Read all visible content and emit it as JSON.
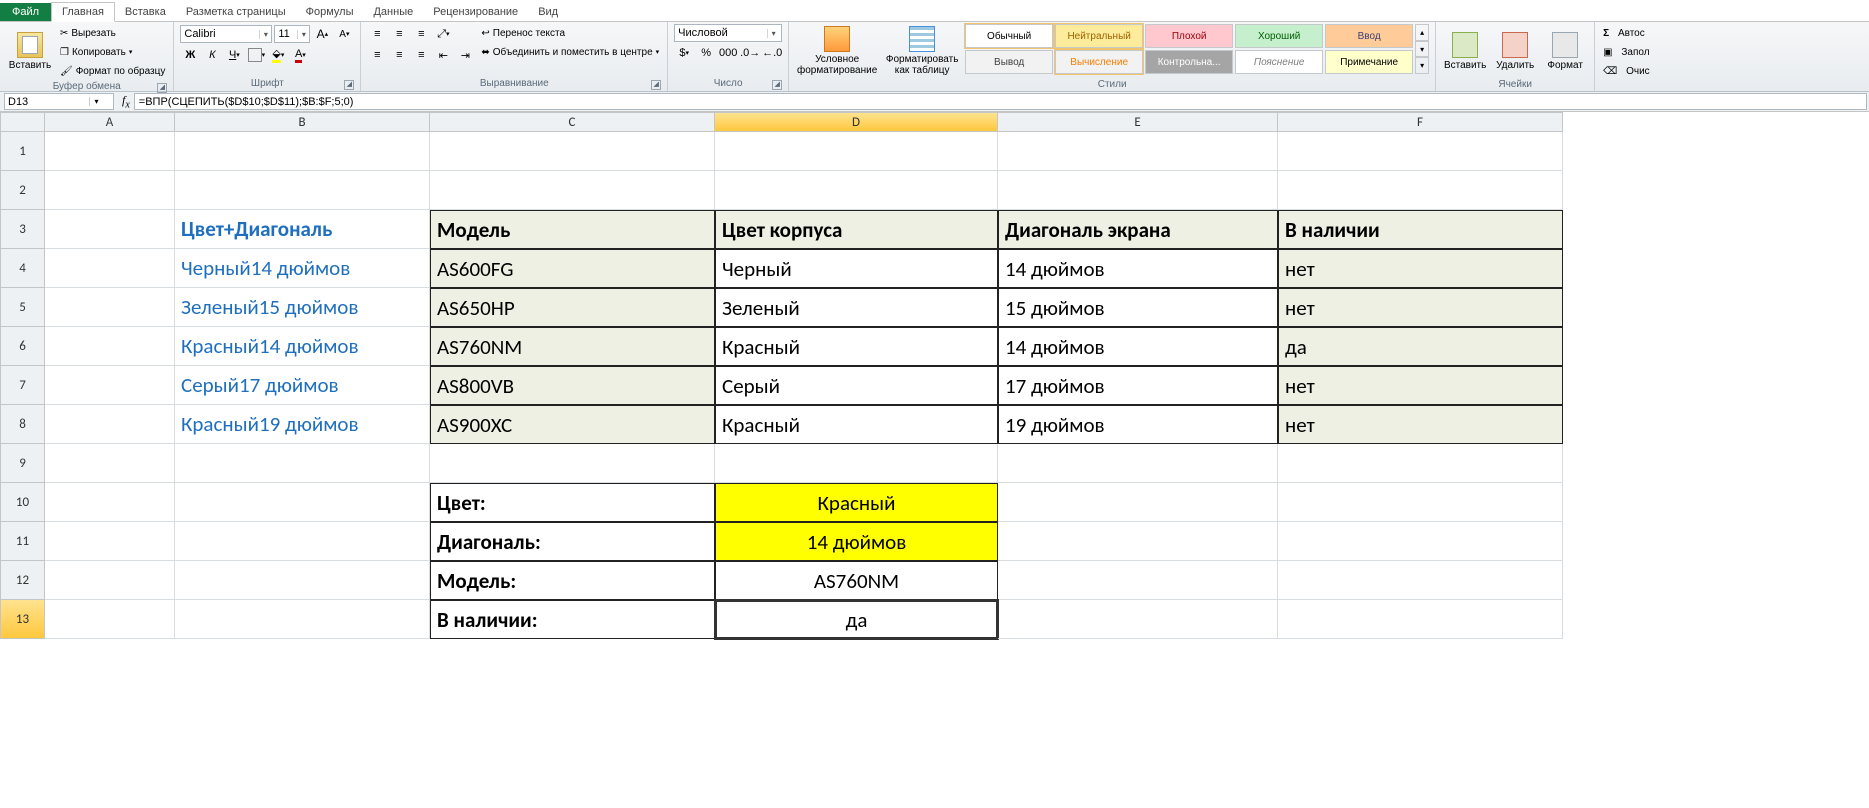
{
  "tabs": {
    "file": "Файл",
    "items": [
      "Главная",
      "Вставка",
      "Разметка страницы",
      "Формулы",
      "Данные",
      "Рецензирование",
      "Вид"
    ],
    "active": 0
  },
  "ribbon": {
    "clipboard": {
      "paste": "Вставить",
      "cut": "Вырезать",
      "copy": "Копировать",
      "format_painter": "Формат по образцу",
      "title": "Буфер обмена"
    },
    "font": {
      "name": "Calibri",
      "size": "11",
      "title": "Шрифт"
    },
    "alignment": {
      "wrap": "Перенос текста",
      "merge": "Объединить и поместить в центре",
      "title": "Выравнивание"
    },
    "number": {
      "format": "Числовой",
      "thousands_sep": "000",
      "title": "Число"
    },
    "styles": {
      "cond_fmt": "Условное форматирование",
      "as_table": "Форматировать как таблицу",
      "gallery": [
        {
          "label": "Обычный",
          "bg": "#ffffff",
          "color": "#000",
          "border": "#f0c36d"
        },
        {
          "label": "Нейтральный",
          "bg": "#ffeb9c",
          "color": "#9c6500",
          "border": "#f0c36d"
        },
        {
          "label": "Плохой",
          "bg": "#ffc7ce",
          "color": "#9c0006"
        },
        {
          "label": "Хороший",
          "bg": "#c6efce",
          "color": "#006100"
        },
        {
          "label": "Ввод",
          "bg": "#ffcc99",
          "color": "#3f3f76"
        },
        {
          "label": "Вывод",
          "bg": "#f2f2f2",
          "color": "#3f3f3f"
        },
        {
          "label": "Вычисление",
          "bg": "#f2f2f2",
          "color": "#fa7d00",
          "border": "#f0c36d"
        },
        {
          "label": "Контрольна...",
          "bg": "#a5a5a5",
          "color": "#ffffff"
        },
        {
          "label": "Пояснение",
          "bg": "#ffffff",
          "color": "#7f7f7f",
          "italic": true
        },
        {
          "label": "Примечание",
          "bg": "#ffffcc",
          "color": "#000"
        }
      ],
      "title": "Стили"
    },
    "cells": {
      "insert": "Вставить",
      "delete": "Удалить",
      "format": "Формат",
      "title": "Ячейки"
    },
    "editing": {
      "autosum": "Автос",
      "fill": "Запол",
      "clear": "Очис"
    }
  },
  "namebox": "D13",
  "formula": "=ВПР(СЦЕПИТЬ($D$10;$D$11);$B:$F;5;0)",
  "grid": {
    "cols": [
      "A",
      "B",
      "C",
      "D",
      "E",
      "F"
    ],
    "selected_col": "D",
    "selected_row": 13,
    "header_row": {
      "B": "Цвет+Диагональ",
      "C": "Модель",
      "D": "Цвет корпуса",
      "E": "Диагональ экрана",
      "F": "В наличии"
    },
    "data_rows": [
      {
        "B": "Черный14 дюймов",
        "C": "AS600FG",
        "D": "Черный",
        "E": "14 дюймов",
        "F": "нет"
      },
      {
        "B": "Зеленый15 дюймов",
        "C": "AS650HP",
        "D": "Зеленый",
        "E": "15 дюймов",
        "F": "нет"
      },
      {
        "B": "Красный14 дюймов",
        "C": "AS760NM",
        "D": "Красный",
        "E": "14 дюймов",
        "F": "да"
      },
      {
        "B": "Серый17 дюймов",
        "C": "AS800VB",
        "D": "Серый",
        "E": "17 дюймов",
        "F": "нет"
      },
      {
        "B": "Красный19 дюймов",
        "C": "AS900XC",
        "D": "Красный",
        "E": "19 дюймов",
        "F": "нет"
      }
    ],
    "lookup": [
      {
        "label": "Цвет:",
        "value": "Красный",
        "yellow": true
      },
      {
        "label": "Диагональ:",
        "value": "14 дюймов",
        "yellow": true
      },
      {
        "label": "Модель:",
        "value": "AS760NM",
        "yellow": false
      },
      {
        "label": "В наличии:",
        "value": "да",
        "yellow": false
      }
    ]
  }
}
